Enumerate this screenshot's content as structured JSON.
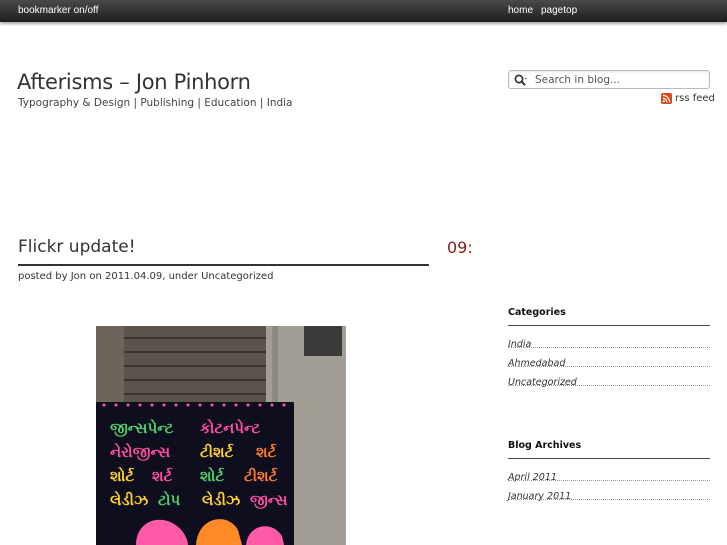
{
  "topbar": {
    "bookmarker": "bookmarker on/off",
    "home": "home",
    "pagetop": "pagetop"
  },
  "header": {
    "title": "Afterisms – Jon Pinhorn",
    "tagline": "Typography & Design | Publishing | Education | India"
  },
  "search": {
    "placeholder": "Search in blog...",
    "icon": "search-icon"
  },
  "rss": {
    "label": "rss feed",
    "icon": "rss-icon",
    "color": "#d64a1b"
  },
  "post": {
    "title": "Flickr update!",
    "time": "09:",
    "meta_prefix": "posted by ",
    "author": "Jon",
    "meta_on": " on ",
    "date": "2011.04.09",
    "meta_under": ", under ",
    "category": "Uncategorized",
    "image": {
      "subject": "Hand-painted Gujarati shop sign",
      "lines": [
        [
          "જીન્સપેન્ટ",
          "કોટનપેન્ટ"
        ],
        [
          "નેરોજીન્સ",
          "ટીશર્ટ",
          "શર્ટ"
        ],
        [
          "શોર્ટ",
          "શર્ટ",
          "શોર્ટ",
          "ટીશર્ટ"
        ],
        [
          "લેડીઝ",
          "ટોપ",
          "લેડીઝ",
          "જીન્સ"
        ]
      ]
    }
  },
  "sidebar": {
    "categories": {
      "title": "Categories",
      "items": [
        "India",
        "Ahmedabad",
        "Uncategorized"
      ]
    },
    "archives": {
      "title": "Blog Archives",
      "items": [
        "April 2011",
        "January 2011"
      ]
    }
  },
  "colors": {
    "accent_time": "#8b1a1a",
    "topbar": "#2a2a2a"
  }
}
